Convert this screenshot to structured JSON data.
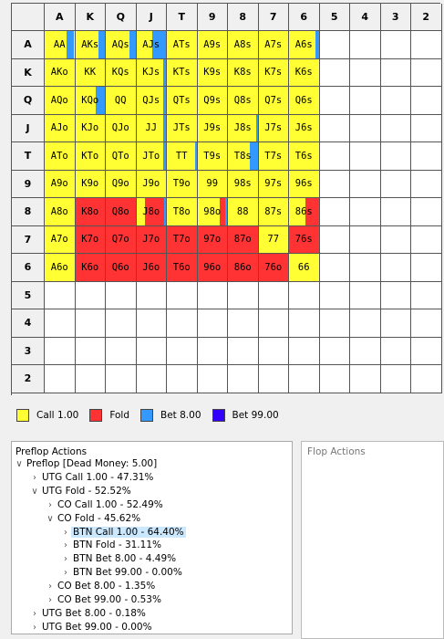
{
  "colors": {
    "call": "#ffff33",
    "fold": "#ff3333",
    "bet8": "#3399ff",
    "bet99": "#3300ff",
    "empty": "#ffffff",
    "header": "#f0f0f0"
  },
  "ranks": [
    "A",
    "K",
    "Q",
    "J",
    "T",
    "9",
    "8",
    "7",
    "6",
    "5",
    "4",
    "3",
    "2"
  ],
  "hands": [
    [
      "AA",
      "AKs",
      "AQs",
      "AJs",
      "ATs",
      "A9s",
      "A8s",
      "A7s",
      "A6s",
      "",
      "",
      "",
      ""
    ],
    [
      "AKo",
      "KK",
      "KQs",
      "KJs",
      "KTs",
      "K9s",
      "K8s",
      "K7s",
      "K6s",
      "",
      "",
      "",
      ""
    ],
    [
      "AQo",
      "KQo",
      "QQ",
      "QJs",
      "QTs",
      "Q9s",
      "Q8s",
      "Q7s",
      "Q6s",
      "",
      "",
      "",
      ""
    ],
    [
      "AJo",
      "KJo",
      "QJo",
      "JJ",
      "JTs",
      "J9s",
      "J8s",
      "J7s",
      "J6s",
      "",
      "",
      "",
      ""
    ],
    [
      "ATo",
      "KTo",
      "QTo",
      "JTo",
      "TT",
      "T9s",
      "T8s",
      "T7s",
      "T6s",
      "",
      "",
      "",
      ""
    ],
    [
      "A9o",
      "K9o",
      "Q9o",
      "J9o",
      "T9o",
      "99",
      "98s",
      "97s",
      "96s",
      "",
      "",
      "",
      ""
    ],
    [
      "A8o",
      "K8o",
      "Q8o",
      "J8o",
      "T8o",
      "98o",
      "88",
      "87s",
      "86s",
      "",
      "",
      "",
      ""
    ],
    [
      "A7o",
      "K7o",
      "Q7o",
      "J7o",
      "T7o",
      "97o",
      "87o",
      "77",
      "76s",
      "",
      "",
      "",
      ""
    ],
    [
      "A6o",
      "K6o",
      "Q6o",
      "J6o",
      "T6o",
      "96o",
      "86o",
      "76o",
      "66",
      "",
      "",
      "",
      ""
    ],
    [
      "",
      "",
      "",
      "",
      "",
      "",
      "",
      "",
      "",
      "",
      "",
      "",
      ""
    ],
    [
      "",
      "",
      "",
      "",
      "",
      "",
      "",
      "",
      "",
      "",
      "",
      "",
      ""
    ],
    [
      "",
      "",
      "",
      "",
      "",
      "",
      "",
      "",
      "",
      "",
      "",
      "",
      ""
    ],
    [
      "",
      "",
      "",
      "",
      "",
      "",
      "",
      "",
      "",
      "",
      "",
      "",
      ""
    ]
  ],
  "strategy": {
    "AA": {
      "call": 0.73,
      "bet8": 0.27
    },
    "AKs": {
      "call": 0.78,
      "bet8": 0.22
    },
    "AQs": {
      "call": 0.8,
      "bet8": 0.2
    },
    "AJs": {
      "call": 0.55,
      "bet8": 0.45
    },
    "A6s": {
      "call": 0.9,
      "bet8": 0.1
    },
    "K6s": {
      "call": 1.0
    },
    "KQo": {
      "call": 0.7,
      "bet8": 0.3
    },
    "KJs": {
      "call": 0.92,
      "bet8": 0.08
    },
    "QJs": {
      "call": 0.92,
      "bet8": 0.08
    },
    "J8s": {
      "call": 0.95,
      "bet8": 0.05
    },
    "JTo": {
      "call": 0.9,
      "bet8": 0.1
    },
    "JJ": {
      "call": 0.92,
      "bet8": 0.08
    },
    "TT": {
      "call": 0.95,
      "bet8": 0.05
    },
    "T8s": {
      "call": 0.75,
      "bet8": 0.25
    },
    "A8o": {
      "call": 1.0
    },
    "K8o": {
      "fold": 1.0
    },
    "Q8o": {
      "fold": 1.0
    },
    "J8o": {
      "call": 0.3,
      "bet8": 0.05,
      "fold": 0.65
    },
    "98o": {
      "call": 0.75,
      "bet8": 0.05,
      "fold": 0.2
    },
    "86s": {
      "call": 0.55,
      "fold": 0.45
    },
    "K7o": {
      "fold": 1.0
    },
    "Q7o": {
      "fold": 1.0
    },
    "J7o": {
      "fold": 1.0
    },
    "T7o": {
      "fold": 1.0
    },
    "97o": {
      "fold": 1.0
    },
    "87o": {
      "fold": 1.0
    },
    "76s": {
      "fold": 1.0
    },
    "K6o": {
      "fold": 1.0
    },
    "Q6o": {
      "fold": 1.0
    },
    "J6o": {
      "fold": 1.0
    },
    "T6o": {
      "fold": 1.0
    },
    "96o": {
      "fold": 1.0
    },
    "86o": {
      "fold": 1.0
    },
    "76o": {
      "fold": 1.0
    }
  },
  "legend": [
    {
      "label": "Call 1.00",
      "color_key": "call"
    },
    {
      "label": "Fold",
      "color_key": "fold"
    },
    {
      "label": "Bet 8.00",
      "color_key": "bet8"
    },
    {
      "label": "Bet 99.00",
      "color_key": "bet99"
    }
  ],
  "actions_panel": {
    "title": "Preflop Actions",
    "tree": [
      {
        "text": "Preflop [Dead Money: 5.00]",
        "depth": 0,
        "state": "expanded"
      },
      {
        "text": "UTG Call 1.00 - 47.31%",
        "depth": 1,
        "state": "collapsed"
      },
      {
        "text": "UTG Fold - 52.52%",
        "depth": 1,
        "state": "expanded"
      },
      {
        "text": "CO Call 1.00 - 52.49%",
        "depth": 2,
        "state": "collapsed"
      },
      {
        "text": "CO Fold - 45.62%",
        "depth": 2,
        "state": "expanded"
      },
      {
        "text": "BTN Call 1.00 - 64.40%",
        "depth": 3,
        "state": "collapsed",
        "selected": true
      },
      {
        "text": "BTN Fold - 31.11%",
        "depth": 3,
        "state": "collapsed"
      },
      {
        "text": "BTN Bet 8.00 - 4.49%",
        "depth": 3,
        "state": "collapsed"
      },
      {
        "text": "BTN Bet 99.00 - 0.00%",
        "depth": 3,
        "state": "collapsed"
      },
      {
        "text": "CO Bet 8.00 - 1.35%",
        "depth": 2,
        "state": "collapsed"
      },
      {
        "text": "CO Bet 99.00 - 0.53%",
        "depth": 2,
        "state": "collapsed"
      },
      {
        "text": "UTG Bet 8.00 - 0.18%",
        "depth": 1,
        "state": "collapsed"
      },
      {
        "text": "UTG Bet 99.00 - 0.00%",
        "depth": 1,
        "state": "collapsed"
      }
    ]
  },
  "flop_panel": {
    "title": "Flop Actions"
  }
}
